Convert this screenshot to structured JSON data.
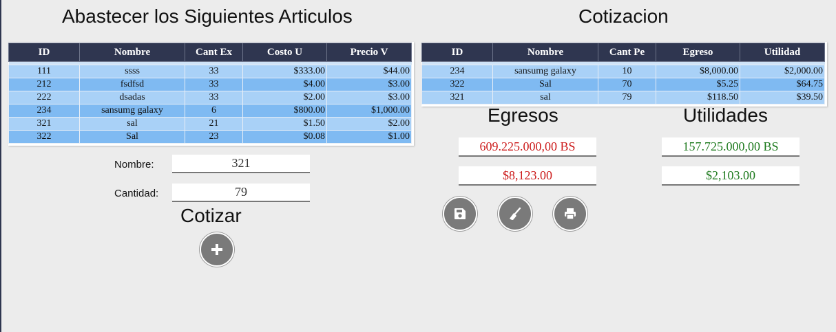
{
  "left": {
    "title": "Abastecer los Siguientes Articulos",
    "columns": [
      "ID",
      "Nombre",
      "Cant Ex",
      "Costo U",
      "Precio V"
    ],
    "rows": [
      [
        "111",
        "ssss",
        "33",
        "$333.00",
        "$44.00"
      ],
      [
        "212",
        "fsdfsd",
        "33",
        "$4.00",
        "$3.00"
      ],
      [
        "222",
        "dsadas",
        "33",
        "$2.00",
        "$3.00"
      ],
      [
        "234",
        "sansumg galaxy",
        "6",
        "$800.00",
        "$1,000.00"
      ],
      [
        "321",
        "sal",
        "21",
        "$1.50",
        "$2.00"
      ],
      [
        "322",
        "Sal",
        "23",
        "$0.08",
        "$1.00"
      ]
    ]
  },
  "form": {
    "nombre_label": "Nombre:",
    "nombre_value": "321",
    "cantidad_label": "Cantidad:",
    "cantidad_value": "79",
    "cotizar_label": "Cotizar",
    "add_icon": "plus-icon"
  },
  "right": {
    "title": "Cotizacion",
    "columns": [
      "ID",
      "Nombre",
      "Cant Pe",
      "Egreso",
      "Utilidad"
    ],
    "rows": [
      [
        "234",
        "sansumg galaxy",
        "10",
        "$8,000.00",
        "$2,000.00"
      ],
      [
        "322",
        "Sal",
        "70",
        "$5.25",
        "$64.75"
      ],
      [
        "321",
        "sal",
        "79",
        "$118.50",
        "$39.50"
      ]
    ]
  },
  "egresos": {
    "title": "Egresos",
    "bs": "609.225.000,00 BS",
    "usd": "$8,123.00",
    "color": "#cc1a1a"
  },
  "utilidades": {
    "title": "Utilidades",
    "bs": "157.725.000,00 BS",
    "usd": "$2,103.00",
    "color": "#1e7a1e"
  },
  "actions": {
    "icons": [
      "save-icon",
      "broom-icon",
      "print-icon"
    ]
  }
}
